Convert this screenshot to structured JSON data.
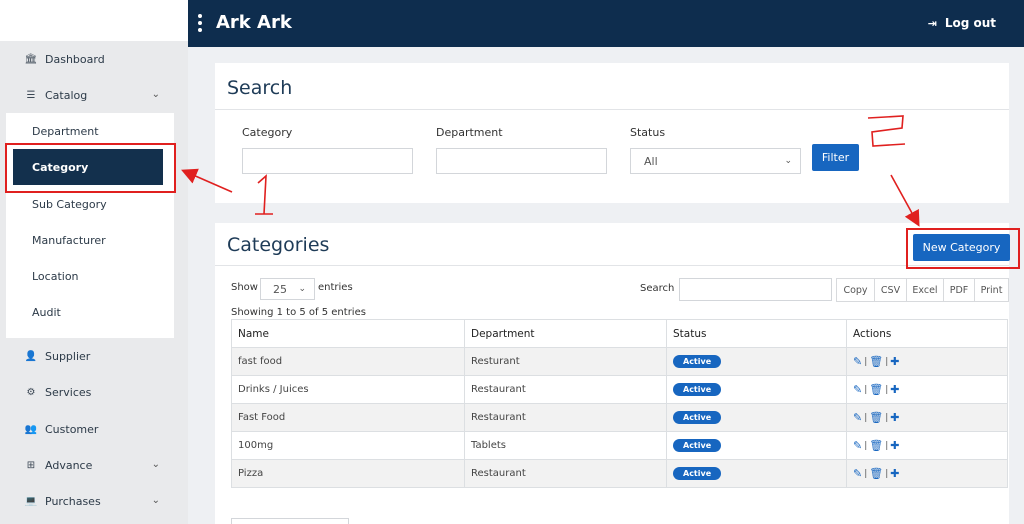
{
  "header": {
    "title": "Ark Ark",
    "logout_label": "Log out"
  },
  "sidebar": {
    "items": [
      {
        "label": "Dashboard",
        "icon": "bank-icon"
      },
      {
        "label": "Catalog",
        "icon": "list-icon"
      },
      {
        "label": "Supplier",
        "icon": "user-icon"
      },
      {
        "label": "Services",
        "icon": "gear-icon"
      },
      {
        "label": "Customer",
        "icon": "users-icon"
      },
      {
        "label": "Advance",
        "icon": "sitemap-icon"
      },
      {
        "label": "Purchases",
        "icon": "laptop-icon"
      }
    ],
    "catalog_sub": [
      "Department",
      "Category",
      "Sub Category",
      "Manufacturer",
      "Location",
      "Audit"
    ]
  },
  "search": {
    "title": "Search",
    "category_label": "Category",
    "department_label": "Department",
    "status_label": "Status",
    "status_value": "All",
    "filter_label": "Filter"
  },
  "categories": {
    "title": "Categories",
    "new_label": "New Category",
    "show_label": "Show",
    "entries_value": "25",
    "entries_label": "entries",
    "search_label": "Search",
    "showing_text": "Showing 1 to 5 of 5 entries",
    "export_buttons": [
      "Copy",
      "CSV",
      "Excel",
      "PDF",
      "Print"
    ],
    "columns": [
      "Name",
      "Department",
      "Status",
      "Actions"
    ],
    "rows": [
      {
        "name": "fast food",
        "department": "Resturant",
        "status": "Active"
      },
      {
        "name": "Drinks / Juices",
        "department": "Restaurant",
        "status": "Active"
      },
      {
        "name": "Fast Food",
        "department": "Restaurant",
        "status": "Active"
      },
      {
        "name": "100mg",
        "department": "Tablets",
        "status": "Active"
      },
      {
        "name": "Pizza",
        "department": "Restaurant",
        "status": "Active"
      }
    ]
  },
  "annotations": {
    "step1": "1",
    "step2": "2",
    "color": "#e0201f"
  }
}
